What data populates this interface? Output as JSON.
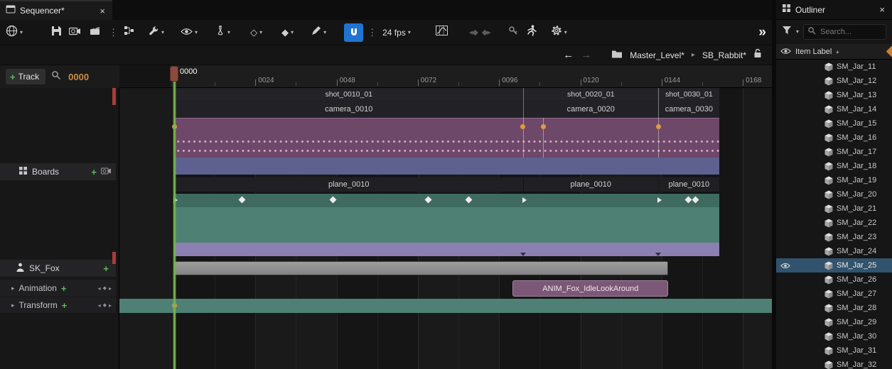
{
  "sequencer": {
    "tab_title": "Sequencer*",
    "toolbar": {
      "fps_label": "24 fps"
    },
    "breadcrumb": {
      "level": "Master_Level*",
      "shot": "SB_Rabbit*"
    },
    "left": {
      "track_button_label": "Track",
      "time_display": "0000",
      "rows": {
        "boards": "Boards",
        "skeleton": "SK_Fox",
        "animation": "Animation",
        "transform": "Transform"
      }
    },
    "timeline": {
      "playhead": {
        "frame": 0,
        "label": "0000"
      },
      "ruler_ticks": [
        {
          "frame": 24,
          "label": "0024"
        },
        {
          "frame": 48,
          "label": "0048"
        },
        {
          "frame": 72,
          "label": "0072"
        },
        {
          "frame": 96,
          "label": "0096"
        },
        {
          "frame": 120,
          "label": "0120"
        },
        {
          "frame": 144,
          "label": "0144"
        },
        {
          "frame": 168,
          "label": "0168"
        }
      ],
      "sections": [
        {
          "start": 0,
          "end": 103,
          "shot": "shot_0010_01",
          "camera": "camera_0010",
          "plane": "plane_0010"
        },
        {
          "start": 103,
          "end": 143,
          "shot": "shot_0020_01",
          "camera": "camera_0020",
          "plane": "plane_0010"
        },
        {
          "start": 143,
          "end": 161,
          "shot": "shot_0030_01",
          "camera": "camera_0030",
          "plane": "plane_0010"
        }
      ],
      "camera_cut_keys": [
        0,
        103,
        109,
        143
      ],
      "marker_lines": [
        103,
        109,
        143
      ],
      "transform_keys_diamond": [
        20,
        47,
        75,
        87,
        152,
        154
      ],
      "transform_keys_arrow": [
        0,
        103,
        143
      ],
      "lavender_notches": [
        103,
        143
      ],
      "gray_bar": {
        "start": 0,
        "end": 146
      },
      "anim_clip": {
        "label": "ANIM_Fox_IdleLookAround",
        "start": 100,
        "end": 146
      },
      "bottom_keys": [
        0
      ]
    }
  },
  "outliner": {
    "title": "Outliner",
    "search_placeholder": "Search...",
    "column_header": "Item Label",
    "items": [
      "SM_Jar_11",
      "SM_Jar_12",
      "SM_Jar_13",
      "SM_Jar_14",
      "SM_Jar_15",
      "SM_Jar_16",
      "SM_Jar_17",
      "SM_Jar_18",
      "SM_Jar_19",
      "SM_Jar_20",
      "SM_Jar_21",
      "SM_Jar_22",
      "SM_Jar_23",
      "SM_Jar_24",
      "SM_Jar_25",
      "SM_Jar_26",
      "SM_Jar_27",
      "SM_Jar_28",
      "SM_Jar_29",
      "SM_Jar_30",
      "SM_Jar_31",
      "SM_Jar_32"
    ],
    "selected_item": "SM_Jar_25"
  }
}
